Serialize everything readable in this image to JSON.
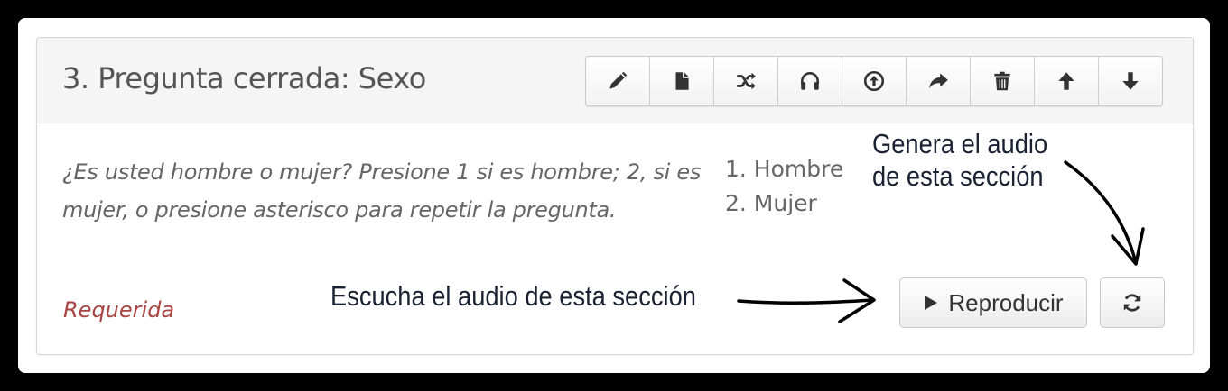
{
  "question": {
    "title": "3. Pregunta cerrada: Sexo",
    "text": "¿Es usted hombre o mujer? Presione 1 si es hombre; 2, si es mujer, o presione asterisco para repetir la pregunta.",
    "options": [
      "1. Hombre",
      "2. Mujer"
    ],
    "required_label": "Requerida"
  },
  "toolbar": {
    "buttons": [
      {
        "name": "edit-button",
        "icon": "pencil-icon"
      },
      {
        "name": "file-button",
        "icon": "file-icon"
      },
      {
        "name": "shuffle-button",
        "icon": "shuffle-icon"
      },
      {
        "name": "headphones-button",
        "icon": "headphones-icon"
      },
      {
        "name": "upload-button",
        "icon": "upload-circle-icon"
      },
      {
        "name": "share-button",
        "icon": "share-arrow-icon"
      },
      {
        "name": "delete-button",
        "icon": "trash-icon"
      },
      {
        "name": "move-up-button",
        "icon": "arrow-up-icon"
      },
      {
        "name": "move-down-button",
        "icon": "arrow-down-icon"
      }
    ]
  },
  "audio": {
    "play_label": "Reproducir",
    "play_icon": "play-icon",
    "refresh_icon": "refresh-icon"
  },
  "annotations": {
    "generate_line1": "Genera el audio",
    "generate_line2": "de esta sección",
    "listen": "Escucha el audio de esta sección"
  },
  "colors": {
    "required": "#a94442",
    "header_bg": "#f5f5f5",
    "annotation_text": "#1a2233"
  }
}
